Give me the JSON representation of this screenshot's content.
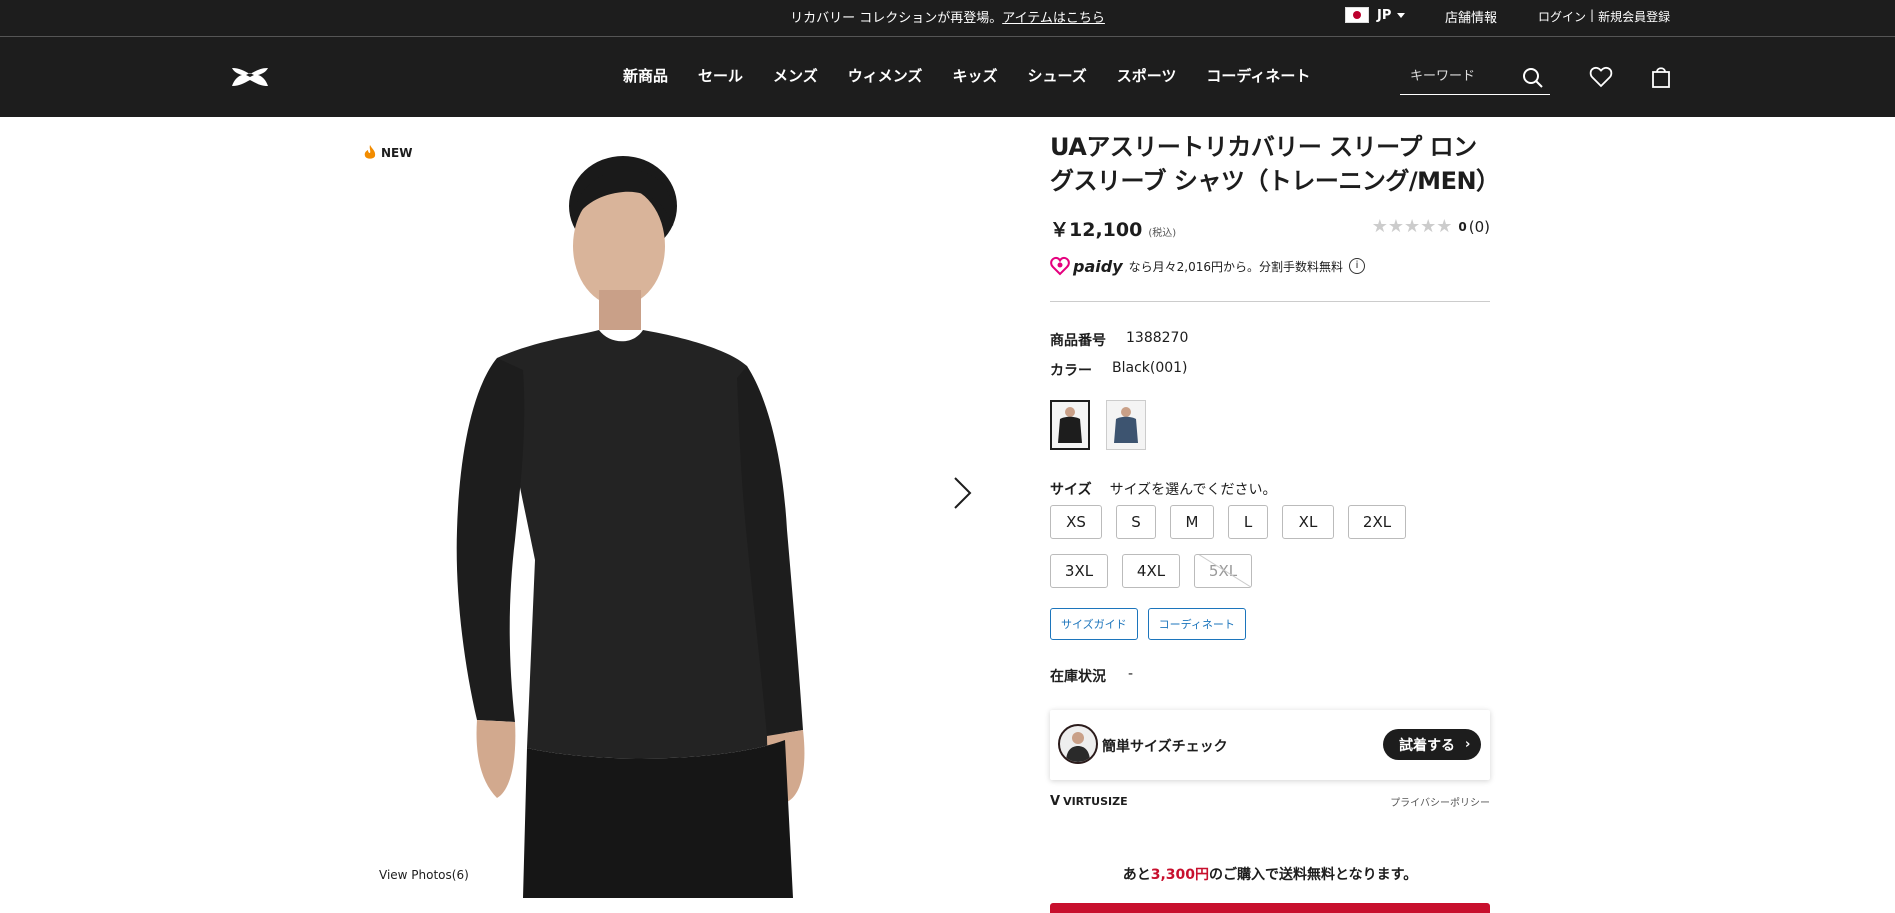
{
  "announcement": {
    "text": "リカバリー コレクションが再登場。",
    "link": "アイテムはこちら",
    "country": "JP",
    "stores": "店舗情報",
    "login": "ログイン",
    "separator": "|",
    "register": "新規会員登録"
  },
  "nav": {
    "items": [
      "新商品",
      "セール",
      "メンズ",
      "ウィメンズ",
      "キッズ",
      "シューズ",
      "スポーツ",
      "コーディネート"
    ],
    "search_placeholder": "キーワード"
  },
  "gallery": {
    "badge": "NEW",
    "view_photos": "View Photos(6)"
  },
  "product": {
    "title": "UAアスリートリカバリー スリープ ロングスリーブ シャツ（トレーニング/MEN）",
    "price": "￥12,100",
    "tax_note": "(税込)",
    "rating": {
      "stars": "★★★★★",
      "score": "0",
      "reviews": "(0)"
    },
    "paidy": {
      "brand": "paidy",
      "text": "なら月々2,016円から。分割手数料無料",
      "info": "i"
    },
    "item_no_label": "商品番号",
    "item_no": "1388270",
    "color_label": "カラー",
    "color_value": "Black(001)",
    "size_label": "サイズ",
    "size_prompt": "サイズを選んでください。",
    "sizes": [
      "XS",
      "S",
      "M",
      "L",
      "XL",
      "2XL",
      "3XL",
      "4XL",
      "5XL"
    ],
    "size_guide": "サイズガイド",
    "coordinate": "コーディネート",
    "stock_label": "在庫状況",
    "stock_value": "-"
  },
  "virtusize": {
    "label": "簡単サイズチェック",
    "button": "試着する",
    "brand": "VIRTUSIZE",
    "privacy": "プライバシーポリシー"
  },
  "shipping": {
    "prefix": "あと",
    "amount": "3,300円",
    "suffix": "のご購入で送料無料となります。"
  },
  "colors": {
    "bar": "#1d1d1d",
    "link_blue": "#1c75bc",
    "accent_red": "#c8102e",
    "paidy_pink": "#e5007e"
  }
}
